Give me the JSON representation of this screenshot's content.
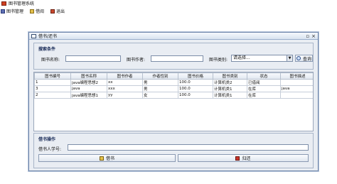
{
  "app": {
    "title": "图书管理系统"
  },
  "menu": {
    "items": [
      {
        "label": "图书管理"
      },
      {
        "label": "借阅"
      },
      {
        "label": "退出"
      }
    ]
  },
  "frame": {
    "title": "借书/还书"
  },
  "search": {
    "group_title": "搜索条件",
    "name_label": "图书名称:",
    "author_label": "图书作者:",
    "type_label": "图书类别:",
    "name_value": "",
    "author_value": "",
    "type_selected": "请选择...",
    "button_label": "查询"
  },
  "table": {
    "headers": [
      "图书编号",
      "图书名称",
      "图书作者",
      "作者性别",
      "图书价格",
      "图书类别",
      "状态",
      "图书描述"
    ],
    "rows": [
      [
        "1",
        "java编程思想2",
        "xx",
        "男",
        "100.0",
        "计算机类2",
        "已借阅",
        ""
      ],
      [
        "3",
        "java",
        "xxx",
        "男",
        "100.0",
        "计算机类1",
        "在库",
        "java"
      ],
      [
        "2",
        "java编程思想1",
        "yy",
        "女",
        "100.0",
        "计算机类1",
        "在库",
        ""
      ]
    ]
  },
  "operation": {
    "group_title": "借书操作",
    "id_label": "借书人学号:",
    "id_value": "",
    "borrow_label": "借书",
    "return_label": "归还"
  },
  "colors": {
    "frame_border": "#6f86aa",
    "panel_bg": "#e9edf3"
  }
}
